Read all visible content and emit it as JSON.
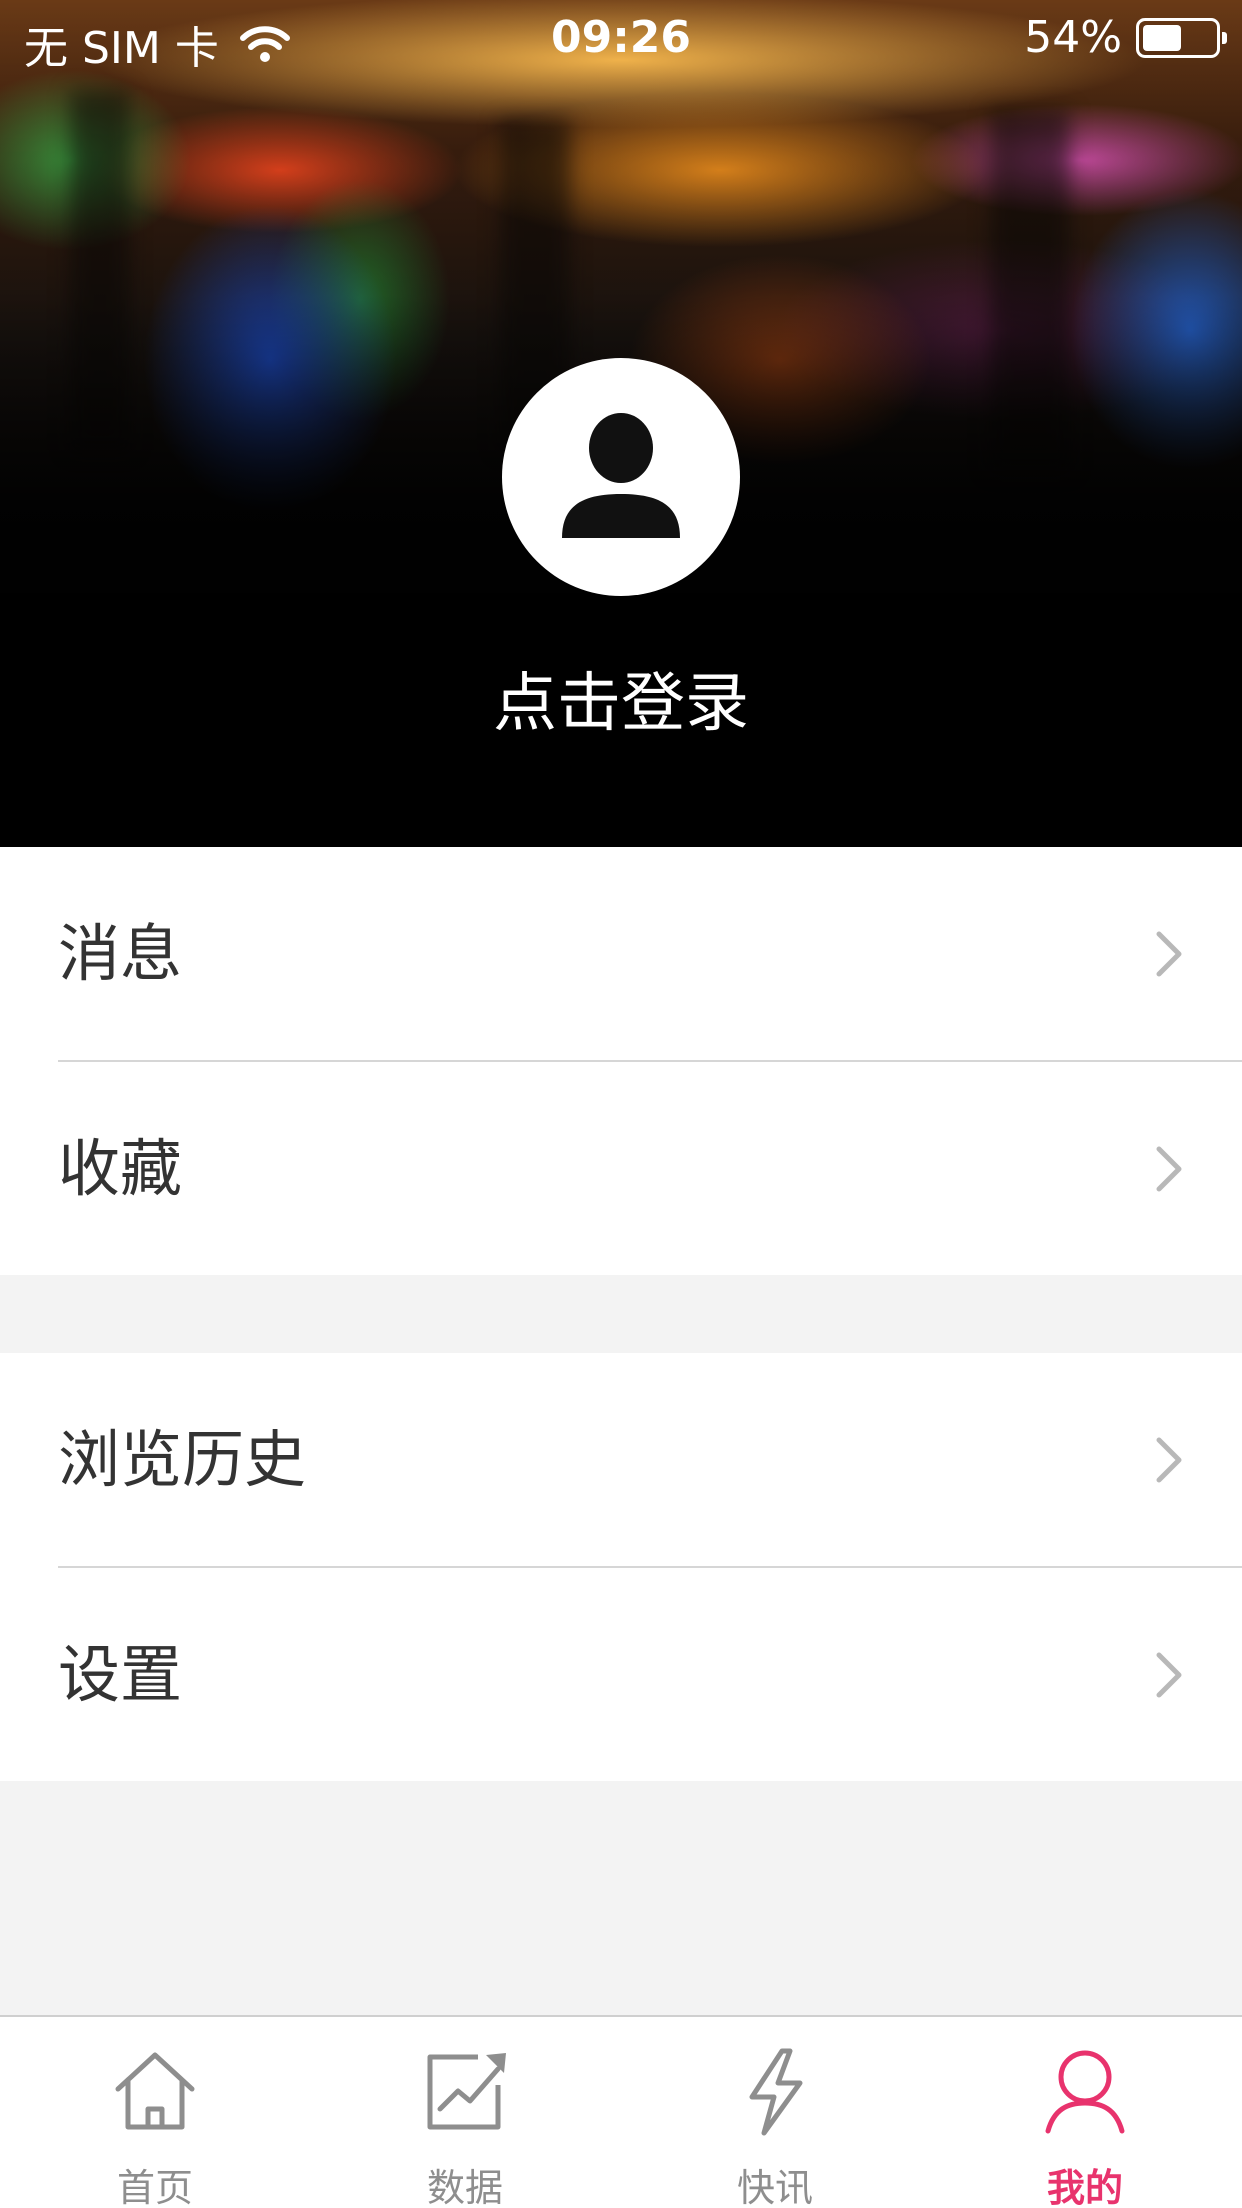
{
  "status_bar": {
    "carrier": "无 SIM 卡",
    "time": "09:26",
    "battery_percent": "54%",
    "battery_level": 0.54,
    "wifi_icon": "wifi-icon"
  },
  "profile": {
    "avatar_icon": "user-avatar-icon",
    "login_text": "点击登录"
  },
  "menu": {
    "group1": [
      {
        "label": "消息",
        "icon": "chevron-right-icon"
      },
      {
        "label": "收藏",
        "icon": "chevron-right-icon"
      }
    ],
    "group2": [
      {
        "label": "浏览历史",
        "icon": "chevron-right-icon"
      },
      {
        "label": "设置",
        "icon": "chevron-right-icon"
      }
    ]
  },
  "tabbar": {
    "tabs": [
      {
        "label": "首页",
        "icon": "home-icon",
        "active": false
      },
      {
        "label": "数据",
        "icon": "chart-icon",
        "active": false
      },
      {
        "label": "快讯",
        "icon": "lightning-icon",
        "active": false
      },
      {
        "label": "我的",
        "icon": "person-icon",
        "active": true
      }
    ]
  },
  "colors": {
    "accent": "#e8336d",
    "inactive_tab": "#8e8e8e",
    "text": "#333333",
    "background": "#f3f3f3"
  }
}
